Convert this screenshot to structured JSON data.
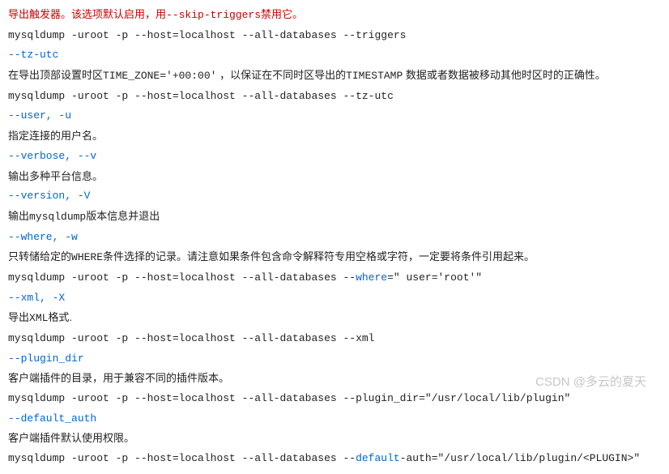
{
  "lines": [
    {
      "cls": "red",
      "parts": [
        {
          "cls": "red",
          "text": "导出触发器。该选项默认启用，用"
        },
        {
          "cls": "red mono",
          "text": "--skip-triggers"
        },
        {
          "cls": "red",
          "text": "禁用它。"
        }
      ]
    },
    {
      "cls": "mono black",
      "text": "mysqldump  -uroot -p --host=localhost --all-databases --triggers"
    },
    {
      "cls": "mono blue",
      "text": "--tz-utc"
    },
    {
      "cls": "black",
      "parts": [
        {
          "cls": "black",
          "text": "在导出顶部设置时区"
        },
        {
          "cls": "mono black",
          "text": "TIME_ZONE='+00:00'"
        },
        {
          "cls": "black",
          "text": " ，以保证在不同时区导出的"
        },
        {
          "cls": "mono black",
          "text": "TIMESTAMP"
        },
        {
          "cls": "black",
          "text": " 数据或者数据被移动其他时区时的正确性。"
        }
      ]
    },
    {
      "cls": "mono black",
      "text": "mysqldump  -uroot -p --host=localhost --all-databases --tz-utc"
    },
    {
      "cls": "mono blue",
      "text": "--user, -u"
    },
    {
      "cls": "black",
      "text": "指定连接的用户名。"
    },
    {
      "cls": "mono blue",
      "text": "--verbose, --v"
    },
    {
      "cls": "black",
      "text": "输出多种平台信息。"
    },
    {
      "cls": "mono blue",
      "text": "--version, -V"
    },
    {
      "cls": "black",
      "parts": [
        {
          "cls": "black",
          "text": "输出"
        },
        {
          "cls": "mono black",
          "text": "mysqldump"
        },
        {
          "cls": "black",
          "text": "版本信息并退出"
        }
      ]
    },
    {
      "cls": "mono blue",
      "text": "--where, -w"
    },
    {
      "cls": "black",
      "parts": [
        {
          "cls": "black",
          "text": "只转储给定的"
        },
        {
          "cls": "mono black",
          "text": "WHERE"
        },
        {
          "cls": "black",
          "text": "条件选择的记录。请注意如果条件包含命令解释符专用空格或字符，一定要将条件引用起来。"
        }
      ]
    },
    {
      "cls": "mono black",
      "parts": [
        {
          "cls": "mono black",
          "text": "mysqldump  -uroot -p --host=localhost --all-databases --"
        },
        {
          "cls": "mono blue",
          "text": "where"
        },
        {
          "cls": "mono black",
          "text": "=\" user='root'\""
        }
      ]
    },
    {
      "cls": "mono blue",
      "text": "--xml, -X"
    },
    {
      "cls": "black",
      "parts": [
        {
          "cls": "black",
          "text": "导出"
        },
        {
          "cls": "mono black",
          "text": "XML"
        },
        {
          "cls": "black",
          "text": "格式."
        }
      ]
    },
    {
      "cls": "mono black",
      "text": "mysqldump  -uroot -p --host=localhost --all-databases --xml"
    },
    {
      "cls": "mono blue",
      "text": "--plugin_dir"
    },
    {
      "cls": "black",
      "text": "客户端插件的目录，用于兼容不同的插件版本。"
    },
    {
      "cls": "mono black",
      "text": "mysqldump  -uroot -p --host=localhost --all-databases --plugin_dir=\"/usr/local/lib/plugin\""
    },
    {
      "cls": "mono blue",
      "text": "--default_auth"
    },
    {
      "cls": "black",
      "text": "客户端插件默认使用权限。"
    },
    {
      "cls": "mono black",
      "parts": [
        {
          "cls": "mono black",
          "text": "mysqldump  -uroot -p --host=localhost --all-databases --"
        },
        {
          "cls": "mono blue",
          "text": "default"
        },
        {
          "cls": "mono black",
          "text": "-auth=\"/usr/local/lib/plugin/<PLUGIN>\""
        }
      ]
    }
  ],
  "watermark": "CSDN @多云的夏天"
}
